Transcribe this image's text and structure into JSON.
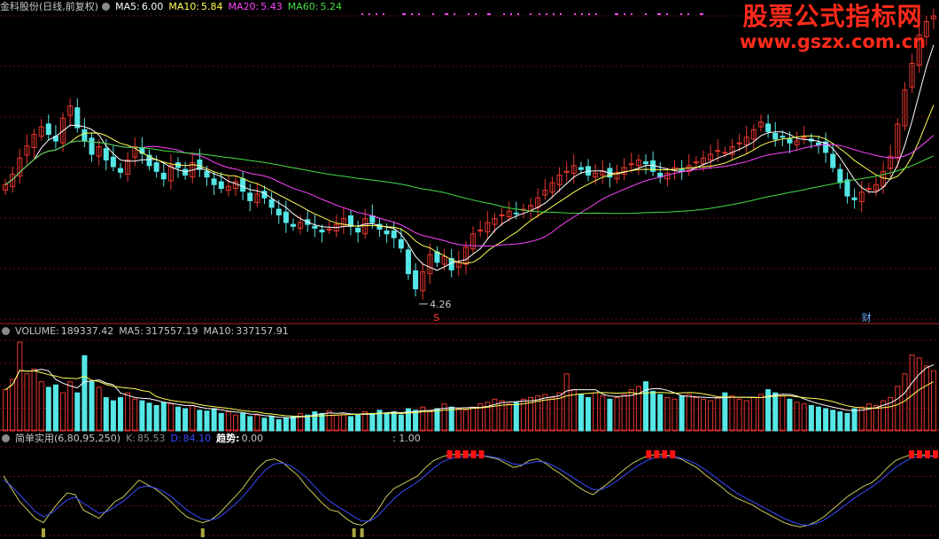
{
  "colors": {
    "bg": "#000000",
    "grid": "#6b0d0d",
    "divider": "#b22222",
    "up": "#e8372f",
    "down": "#55e6e6",
    "ma5": "#ffffff",
    "ma10": "#ffff55",
    "ma20": "#ff44ff",
    "ma60": "#44dd44",
    "k_line": "#c8c85a",
    "d_line": "#3a4aff",
    "signal": "#ff1111",
    "bottom_signal": "#a6a640"
  },
  "price_panel": {
    "stock_name": "金科股份(日线,前复权)",
    "ma5": {
      "label": "MA5:",
      "value": "6.00"
    },
    "ma10": {
      "label": "MA10:",
      "value": "5.84"
    },
    "ma20": {
      "label": "MA20:",
      "value": "5.43"
    },
    "ma60": {
      "label": "MA60:",
      "value": "5.24"
    },
    "low_annotation": "4.26",
    "marker_s": "S",
    "marker_cai": "财"
  },
  "volume_panel": {
    "title": "VOLUME:",
    "value": "189337.42",
    "ma5_label": "MA5:",
    "ma5_value": "317557.19",
    "ma10_label": "MA10:",
    "ma10_value": "337157.91"
  },
  "indicator_panel": {
    "name": "简单实用(6,80,95,250)",
    "k_label": "K:",
    "k_value": "85.53",
    "d_label": "D:",
    "d_value": "84.10",
    "trend_label": "趋势:",
    "trend_value": "0.00",
    "extra_value": ": 1.00"
  },
  "watermark": {
    "line1": "股票公式指标网",
    "line2": "www.gszx.com.cn"
  },
  "chart_data": {
    "type": "candlestick",
    "price_range": [
      4.1,
      7.3
    ],
    "low_point": 4.26,
    "closes": [
      5.52,
      5.63,
      5.8,
      5.93,
      6.05,
      6.13,
      6.05,
      5.98,
      6.22,
      6.35,
      6.12,
      5.98,
      5.84,
      5.92,
      5.78,
      5.71,
      5.65,
      5.78,
      5.92,
      5.85,
      5.72,
      5.66,
      5.58,
      5.72,
      5.7,
      5.62,
      5.75,
      5.68,
      5.6,
      5.52,
      5.48,
      5.5,
      5.55,
      5.45,
      5.35,
      5.42,
      5.38,
      5.28,
      5.2,
      5.12,
      5.08,
      5.12,
      5.1,
      5.06,
      5.02,
      5.05,
      5.1,
      5.16,
      5.08,
      5.02,
      5.16,
      5.12,
      5.05,
      5.0,
      4.96,
      4.85,
      4.58,
      4.42,
      4.6,
      4.78,
      4.7,
      4.76,
      4.62,
      4.7,
      4.86,
      5.0,
      5.04,
      5.12,
      5.16,
      5.2,
      5.24,
      5.22,
      5.26,
      5.3,
      5.38,
      5.46,
      5.54,
      5.62,
      5.66,
      5.72,
      5.68,
      5.62,
      5.64,
      5.66,
      5.6,
      5.65,
      5.7,
      5.74,
      5.78,
      5.74,
      5.66,
      5.6,
      5.64,
      5.7,
      5.68,
      5.72,
      5.76,
      5.8,
      5.84,
      5.88,
      5.86,
      5.92,
      5.96,
      6.02,
      6.1,
      6.18,
      6.08,
      6.0,
      6.02,
      5.96,
      5.98,
      6.02,
      5.98,
      5.94,
      5.86,
      5.7,
      5.54,
      5.4,
      5.36,
      5.44,
      5.48,
      5.52,
      5.66,
      5.82,
      6.16,
      6.52,
      6.8,
      7.1,
      7.24,
      7.3
    ],
    "volumes": [
      0.52,
      0.65,
      1.12,
      0.72,
      0.78,
      0.62,
      0.55,
      0.58,
      0.48,
      0.62,
      0.48,
      0.95,
      0.62,
      0.55,
      0.42,
      0.38,
      0.42,
      0.48,
      0.4,
      0.38,
      0.35,
      0.32,
      0.36,
      0.34,
      0.3,
      0.28,
      0.32,
      0.26,
      0.25,
      0.28,
      0.22,
      0.24,
      0.2,
      0.22,
      0.18,
      0.2,
      0.16,
      0.18,
      0.14,
      0.16,
      0.18,
      0.22,
      0.2,
      0.24,
      0.22,
      0.25,
      0.2,
      0.22,
      0.18,
      0.2,
      0.24,
      0.22,
      0.26,
      0.22,
      0.24,
      0.2,
      0.28,
      0.26,
      0.3,
      0.24,
      0.28,
      0.34,
      0.3,
      0.28,
      0.26,
      0.3,
      0.34,
      0.36,
      0.4,
      0.38,
      0.34,
      0.36,
      0.4,
      0.42,
      0.44,
      0.46,
      0.42,
      0.48,
      0.72,
      0.52,
      0.46,
      0.42,
      0.48,
      0.44,
      0.4,
      0.42,
      0.46,
      0.52,
      0.56,
      0.62,
      0.5,
      0.46,
      0.42,
      0.4,
      0.44,
      0.46,
      0.42,
      0.4,
      0.38,
      0.42,
      0.48,
      0.44,
      0.4,
      0.38,
      0.42,
      0.46,
      0.52,
      0.48,
      0.44,
      0.4,
      0.36,
      0.34,
      0.32,
      0.3,
      0.28,
      0.26,
      0.24,
      0.22,
      0.28,
      0.3,
      0.34,
      0.32,
      0.38,
      0.42,
      0.56,
      0.72,
      0.96,
      0.92,
      0.82,
      0.76
    ],
    "k_values": [
      70,
      55,
      40,
      30,
      20,
      15,
      28,
      40,
      50,
      48,
      30,
      25,
      20,
      30,
      40,
      45,
      55,
      65,
      60,
      55,
      48,
      40,
      30,
      22,
      18,
      15,
      18,
      25,
      35,
      45,
      55,
      68,
      80,
      88,
      90,
      86,
      78,
      70,
      58,
      48,
      38,
      30,
      28,
      20,
      14,
      12,
      18,
      30,
      45,
      55,
      60,
      65,
      70,
      80,
      88,
      92,
      95,
      95,
      95,
      95,
      94,
      92,
      90,
      85,
      80,
      82,
      88,
      90,
      85,
      78,
      72,
      65,
      58,
      52,
      48,
      55,
      62,
      70,
      78,
      85,
      90,
      94,
      95,
      95,
      93,
      90,
      85,
      80,
      72,
      65,
      58,
      50,
      44,
      40,
      36,
      30,
      25,
      20,
      15,
      12,
      10,
      12,
      16,
      22,
      30,
      38,
      46,
      52,
      58,
      62,
      70,
      80,
      88,
      92,
      95,
      95,
      94,
      93
    ],
    "d_values": [
      65,
      58,
      48,
      38,
      28,
      22,
      26,
      34,
      42,
      45,
      38,
      32,
      26,
      28,
      34,
      40,
      48,
      56,
      58,
      56,
      52,
      46,
      38,
      30,
      24,
      19,
      18,
      21,
      28,
      36,
      45,
      56,
      68,
      78,
      84,
      85,
      82,
      76,
      68,
      58,
      48,
      40,
      34,
      28,
      22,
      17,
      17,
      23,
      33,
      43,
      51,
      57,
      63,
      71,
      79,
      86,
      90,
      92,
      93,
      94,
      94,
      93,
      91,
      88,
      84,
      83,
      85,
      87,
      86,
      82,
      77,
      71,
      65,
      59,
      54,
      54,
      58,
      64,
      71,
      78,
      84,
      89,
      92,
      93,
      93,
      91,
      88,
      84,
      78,
      71,
      64,
      57,
      50,
      45,
      40,
      35,
      30,
      25,
      20,
      16,
      13,
      12,
      14,
      18,
      24,
      31,
      38,
      45,
      51,
      57,
      64,
      72,
      80,
      86,
      91,
      93,
      93,
      93
    ]
  }
}
